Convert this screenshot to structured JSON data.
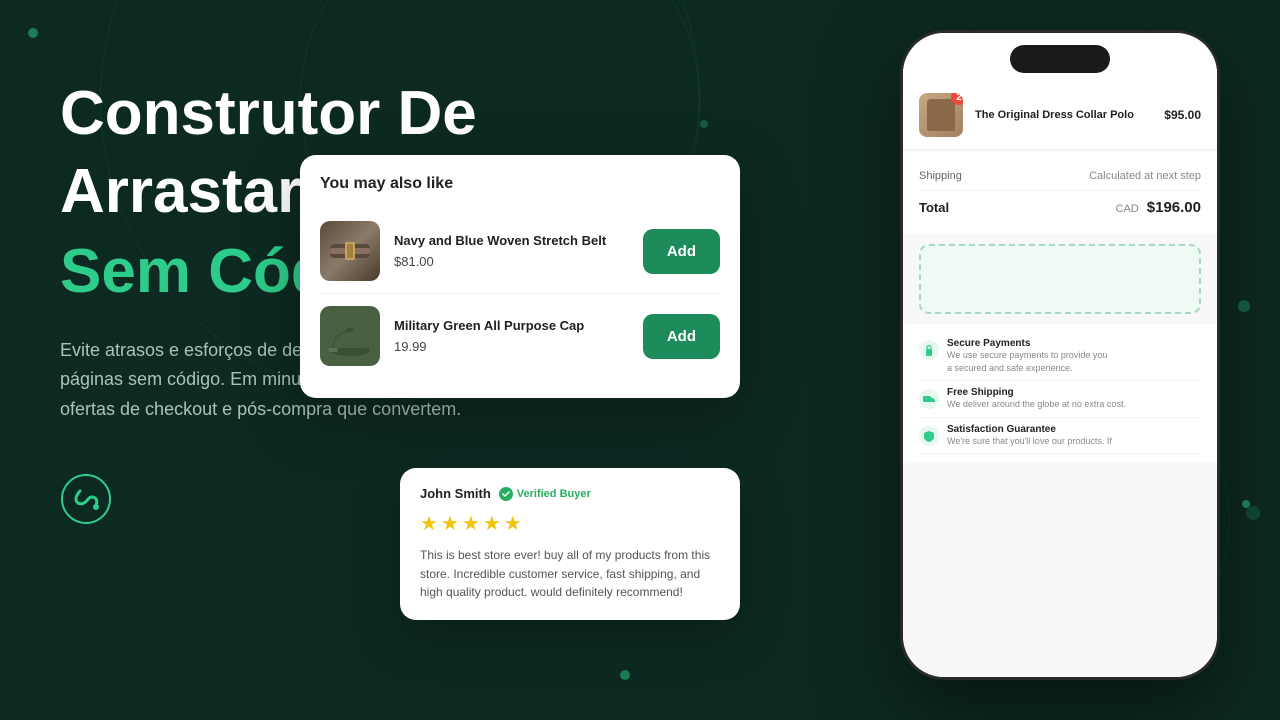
{
  "background": {
    "color": "#0d2a22"
  },
  "hero": {
    "headline_line1": "Construtor De",
    "headline_line2": "Arrastar E Soltar",
    "headline_green": "Sem Código",
    "description": "Evite atrasos e esforços de desenvolvimento com um editor de páginas sem código. Em minutos, você pode criar e publicar ofertas de checkout e pós-compra que convertem."
  },
  "phone": {
    "cart_item": {
      "name": "The Original Dress Collar Polo",
      "price": "$95.00",
      "badge": "2"
    },
    "shipping": {
      "label": "Shipping",
      "value": "Calculated at next step"
    },
    "total": {
      "label": "Total",
      "currency": "CAD",
      "value": "$196.00"
    },
    "trust_items": [
      {
        "title": "Secure Payments",
        "desc": "We use secure payments to provide you a secured and safe experience."
      },
      {
        "title": "Free Shipping",
        "desc": "We deliver around the globe at no extra cost."
      },
      {
        "title": "Satisfaction Guarantee",
        "desc": "We're sure that you'll love our products. If"
      }
    ]
  },
  "upsell": {
    "title": "You may also like",
    "items": [
      {
        "name": "Navy and Blue Woven Stretch Belt",
        "price": "$81.00",
        "button_label": "Add"
      },
      {
        "name": "Military Green All Purpose Cap",
        "price": "19.99",
        "button_label": "Add"
      }
    ]
  },
  "review": {
    "reviewer": "John Smith",
    "verified_label": "Verified Buyer",
    "stars": 5,
    "text": "This is best store ever! buy all of my products from this store. Incredible customer service, fast shipping, and high quality product. would definitely recommend!"
  }
}
